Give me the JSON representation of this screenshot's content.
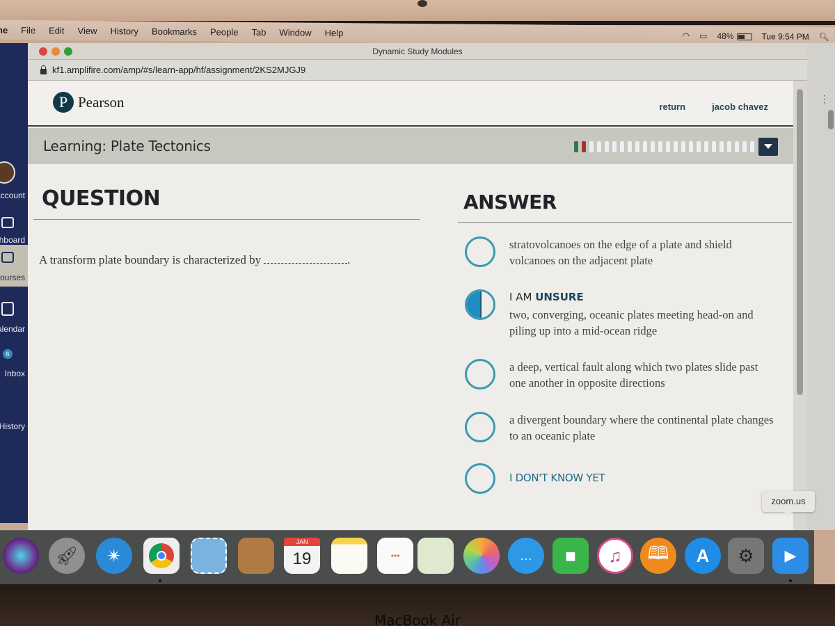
{
  "menubar": {
    "app_partial": "ne",
    "items": [
      "File",
      "Edit",
      "View",
      "History",
      "Bookmarks",
      "People",
      "Tab",
      "Window",
      "Help"
    ],
    "battery": "48%",
    "clock": "Tue 9:54 PM"
  },
  "browser": {
    "window_title": "Dynamic Study Modules",
    "url": "kf1.amplifire.com/amp/#s/learn-app/hf/assignment/2KS2MJGJ9"
  },
  "header": {
    "logo_text": "Pearson",
    "logo_letter": "P",
    "return_label": "return",
    "user_name": "jacob chavez"
  },
  "module": {
    "title": "Learning: Plate Tectonics",
    "progress_segments": [
      "correct",
      "incorrect",
      "pending",
      "pending",
      "pending",
      "pending",
      "pending",
      "pending",
      "pending",
      "pending",
      "pending",
      "pending",
      "pending",
      "pending",
      "pending",
      "pending",
      "pending",
      "pending",
      "pending",
      "pending",
      "pending",
      "pending",
      "pending",
      "pending"
    ]
  },
  "question": {
    "heading": "QUESTION",
    "text": "A transform plate boundary is characterized by",
    "trailing": "."
  },
  "answer": {
    "heading": "ANSWER",
    "options": [
      {
        "text": "stratovolcanoes on the edge of a plate and shield volcanoes on the adjacent plate",
        "state": "empty"
      },
      {
        "prefix": "I AM",
        "confidence": "UNSURE",
        "text": "two, converging, oceanic plates meeting head-on and piling up into a mid-ocean ridge",
        "state": "half"
      },
      {
        "text": "a deep, vertical fault along which two plates slide past one another in opposite directions",
        "state": "empty"
      },
      {
        "text": "a divergent boundary where the continental plate changes to an oceanic plate",
        "state": "empty"
      }
    ],
    "dont_know": "I DON'T KNOW YET"
  },
  "canvas_nav": {
    "items": [
      {
        "label": "Account"
      },
      {
        "label": "Dashboard"
      },
      {
        "label": "Courses",
        "active": true
      },
      {
        "label": "Calendar"
      },
      {
        "label": "Inbox",
        "badge": "6"
      },
      {
        "label": "History"
      }
    ]
  },
  "dock": {
    "tooltip": "zoom.us",
    "calendar_month": "JAN",
    "calendar_day": "19",
    "apps": [
      "Siri",
      "Launchpad",
      "Safari",
      "Chrome",
      "Mail",
      "Contacts",
      "Calendar",
      "Notes",
      "Reminders",
      "Maps",
      "Photos",
      "Messages",
      "FaceTime",
      "iTunes",
      "iBooks",
      "App Store",
      "System Preferences",
      "Zoom"
    ]
  },
  "device_label": "MacBook Air"
}
